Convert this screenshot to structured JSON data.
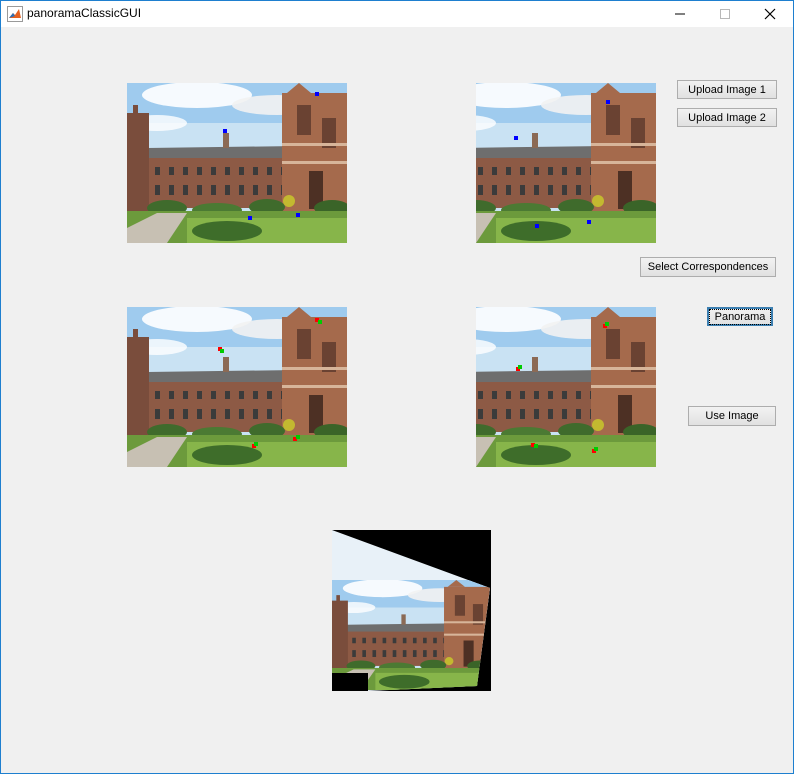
{
  "window": {
    "title": "panoramaClassicGUI",
    "icon": "matlab-icon",
    "controls": [
      "minimize-icon",
      "maximize-icon",
      "close-icon"
    ]
  },
  "buttons": {
    "upload1": "Upload Image 1",
    "upload2": "Upload Image 2",
    "select_correspondences": "Select Correspondences",
    "panorama": "Panorama",
    "use_image": "Use Image"
  },
  "colors": {
    "accent": "#1e7fcf",
    "marker_blue": "#0000ff",
    "marker_red": "#ff0000",
    "marker_green": "#00cc00",
    "background": "#f0f0f0"
  }
}
